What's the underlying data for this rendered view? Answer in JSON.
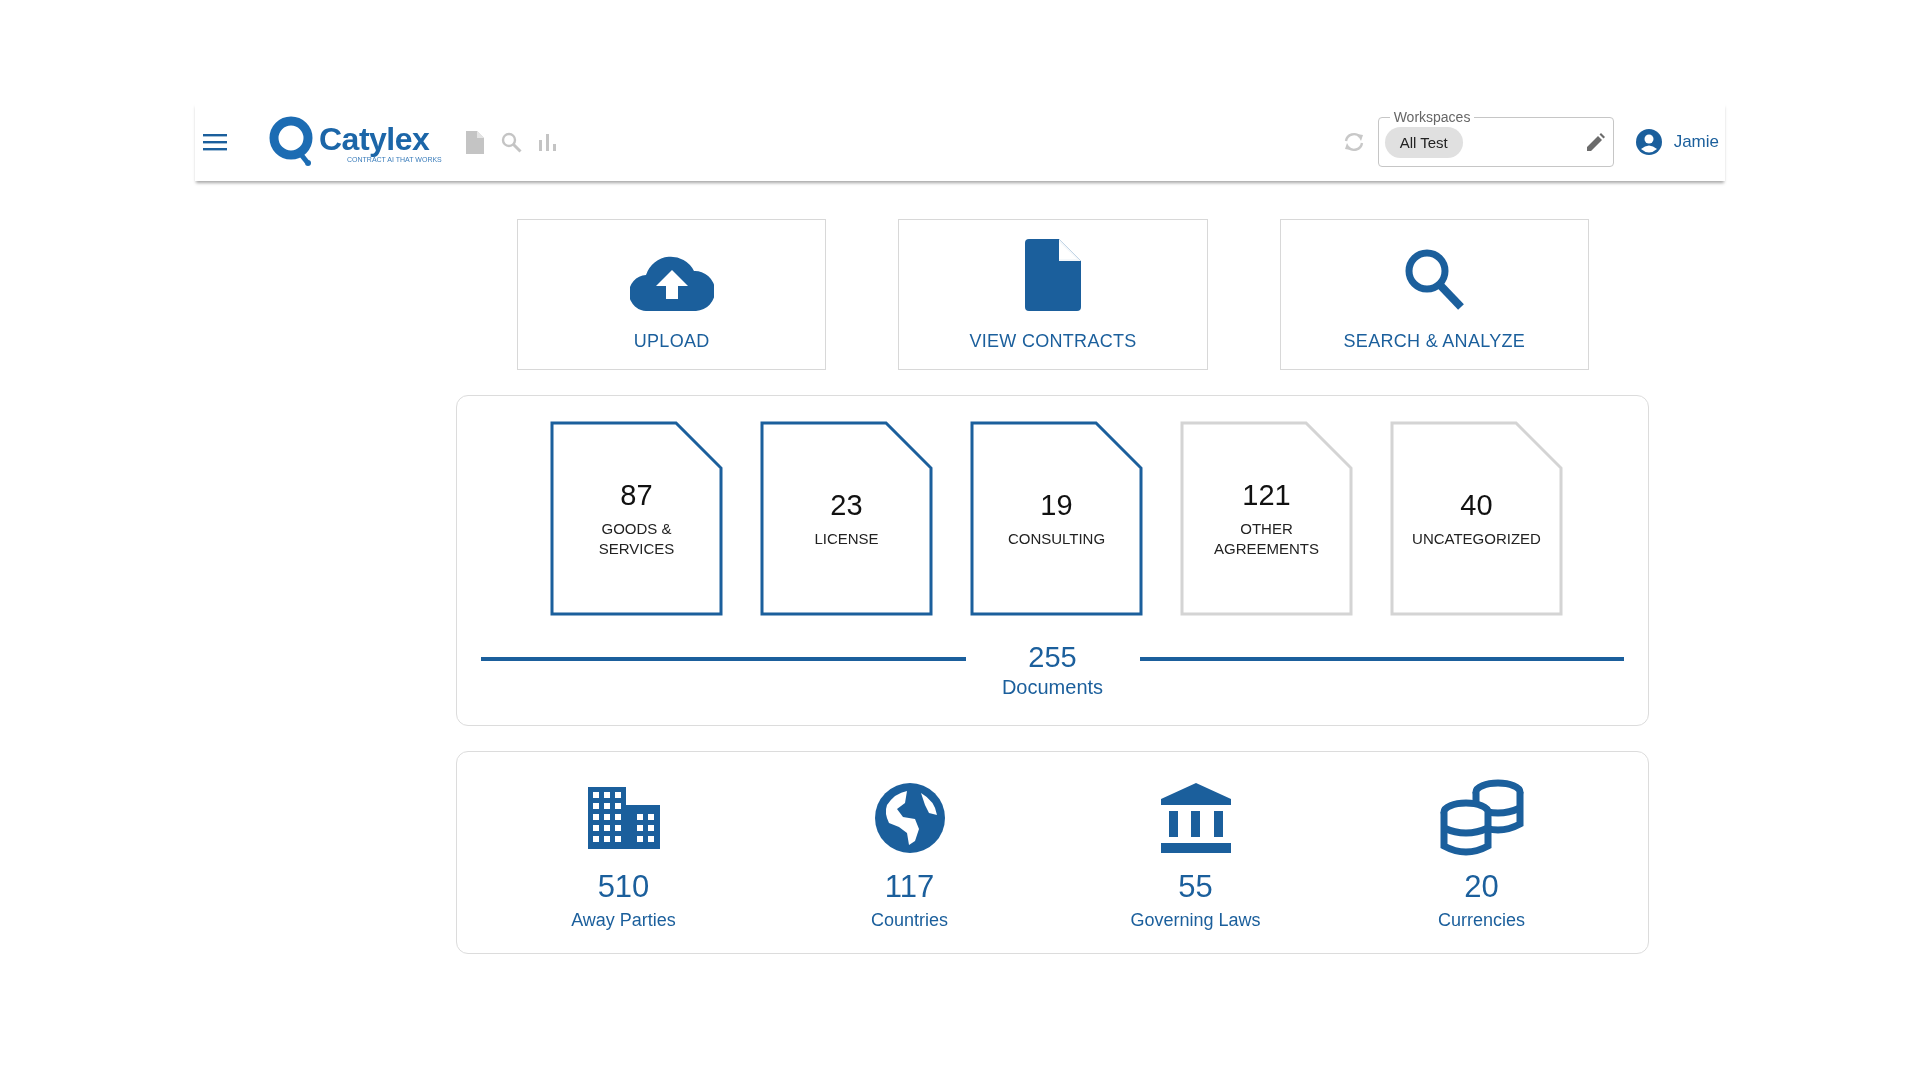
{
  "header": {
    "logo": {
      "name": "Catylex",
      "tagline": "CONTRACT AI THAT WORKS"
    },
    "workspace": {
      "label": "Workspaces",
      "chip": "All Test"
    },
    "user": "Jamie"
  },
  "actions": [
    {
      "kind": "upload",
      "label": "UPLOAD"
    },
    {
      "kind": "contracts",
      "label": "VIEW CONTRACTS"
    },
    {
      "kind": "search",
      "label": "SEARCH & ANALYZE"
    }
  ],
  "categories": [
    {
      "count": "87",
      "label": "GOODS & SERVICES",
      "active": true
    },
    {
      "count": "23",
      "label": "LICENSE",
      "active": true
    },
    {
      "count": "19",
      "label": "CONSULTING",
      "active": true
    },
    {
      "count": "121",
      "label": "OTHER AGREEMENTS",
      "active": false
    },
    {
      "count": "40",
      "label": "UNCATEGORIZED",
      "active": false
    }
  ],
  "total": {
    "count": "255",
    "label": "Documents"
  },
  "stats": [
    {
      "kind": "building",
      "count": "510",
      "label": "Away Parties"
    },
    {
      "kind": "globe",
      "count": "117",
      "label": "Countries"
    },
    {
      "kind": "bank",
      "count": "55",
      "label": "Governing Laws"
    },
    {
      "kind": "coins",
      "count": "20",
      "label": "Currencies"
    }
  ]
}
